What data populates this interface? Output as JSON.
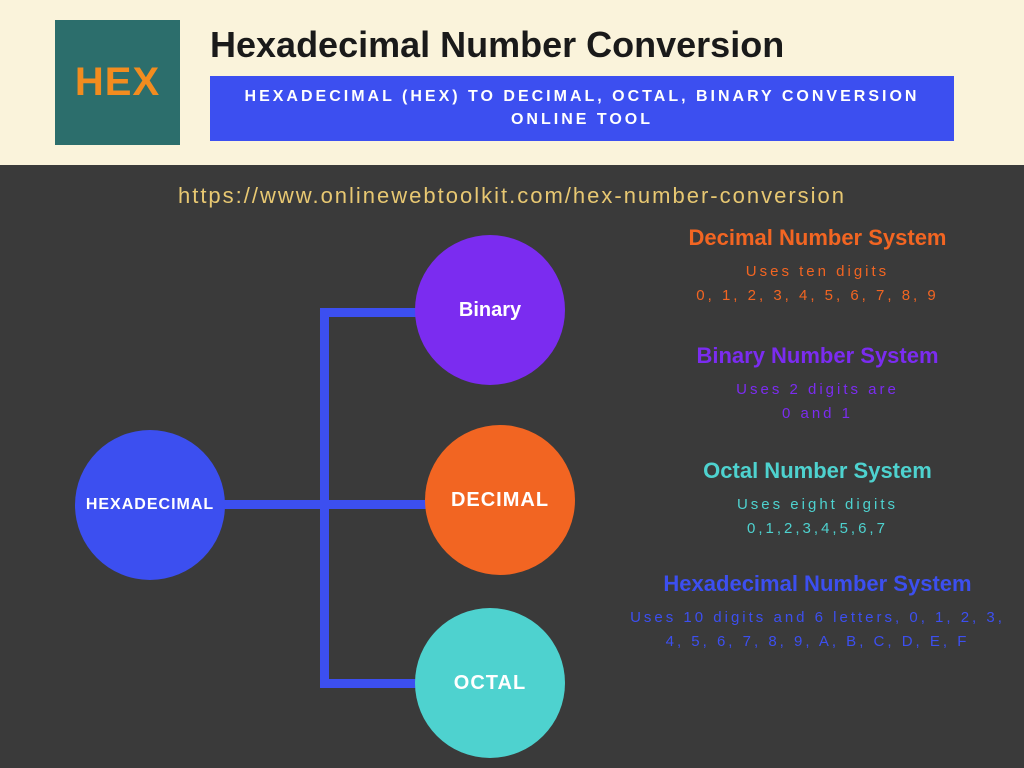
{
  "header": {
    "logo_text": "HEX",
    "main_title": "Hexadecimal Number Conversion",
    "subtitle": "HEXADECIMAL (HEX) TO DECIMAL, OCTAL, BINARY CONVERSION ONLINE TOOL"
  },
  "url": "https://www.onlinewebtoolkit.com/hex-number-conversion",
  "diagram": {
    "root": "HEXADECIMAL",
    "leaves": {
      "binary": "Binary",
      "decimal": "DECIMAL",
      "octal": "OCTAL"
    }
  },
  "info": {
    "decimal": {
      "title": "Decimal Number System",
      "desc": "Uses ten digits\n0, 1, 2, 3, 4, 5, 6, 7, 8, 9"
    },
    "binary": {
      "title": "Binary Number System",
      "desc": "Uses 2 digits are\n0 and 1"
    },
    "octal": {
      "title": "Octal Number System",
      "desc": "Uses eight digits\n0,1,2,3,4,5,6,7"
    },
    "hex": {
      "title": "Hexadecimal Number System",
      "desc": "Uses 10 digits and 6 letters, 0, 1, 2, 3, 4, 5, 6, 7, 8, 9, A, B, C, D, E, F"
    }
  },
  "colors": {
    "cream": "#faf3db",
    "teal": "#2c6e6c",
    "orange_logo": "#f28c1f",
    "blue": "#3c4ff0",
    "purple": "#7b2cf0",
    "orange": "#f26522",
    "cyan": "#4ed2cf",
    "dark": "#3a3a3a",
    "gold": "#e8c872"
  }
}
